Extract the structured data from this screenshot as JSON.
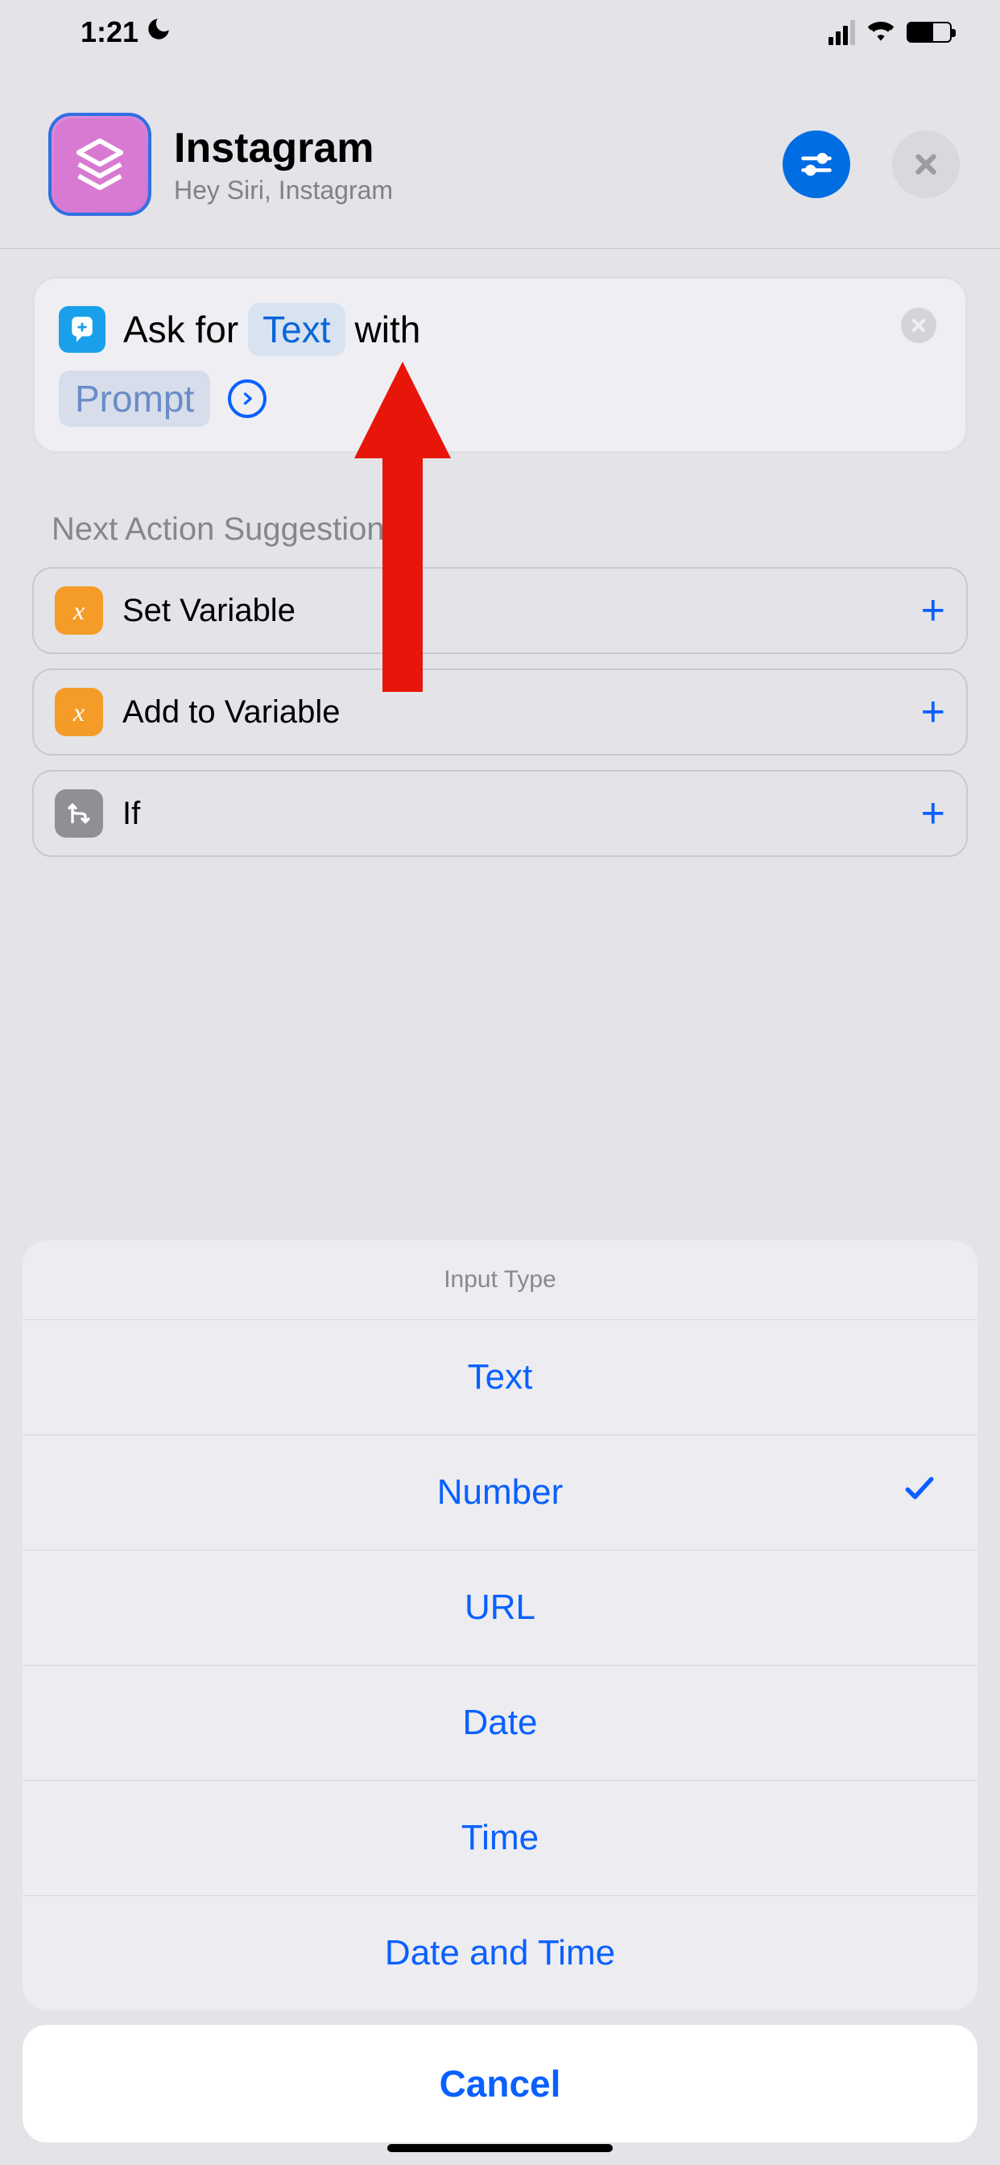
{
  "status": {
    "time": "1:21"
  },
  "header": {
    "title": "Instagram",
    "subtitle": "Hey Siri, Instagram"
  },
  "action": {
    "prefix": "Ask for",
    "type_chip": "Text",
    "suffix": "with",
    "prompt_chip": "Prompt"
  },
  "suggestions": {
    "heading": "Next Action Suggestions",
    "items": [
      {
        "label": "Set Variable",
        "icon": "x",
        "cls": "sugg-orange"
      },
      {
        "label": "Add to Variable",
        "icon": "x",
        "cls": "sugg-orange"
      },
      {
        "label": "If",
        "icon": "⎇",
        "cls": "sugg-gray"
      }
    ]
  },
  "sheet": {
    "title": "Input Type",
    "options": [
      {
        "label": "Text",
        "selected": false
      },
      {
        "label": "Number",
        "selected": true
      },
      {
        "label": "URL",
        "selected": false
      },
      {
        "label": "Date",
        "selected": false
      },
      {
        "label": "Time",
        "selected": false
      },
      {
        "label": "Date and Time",
        "selected": false
      }
    ],
    "cancel": "Cancel"
  }
}
